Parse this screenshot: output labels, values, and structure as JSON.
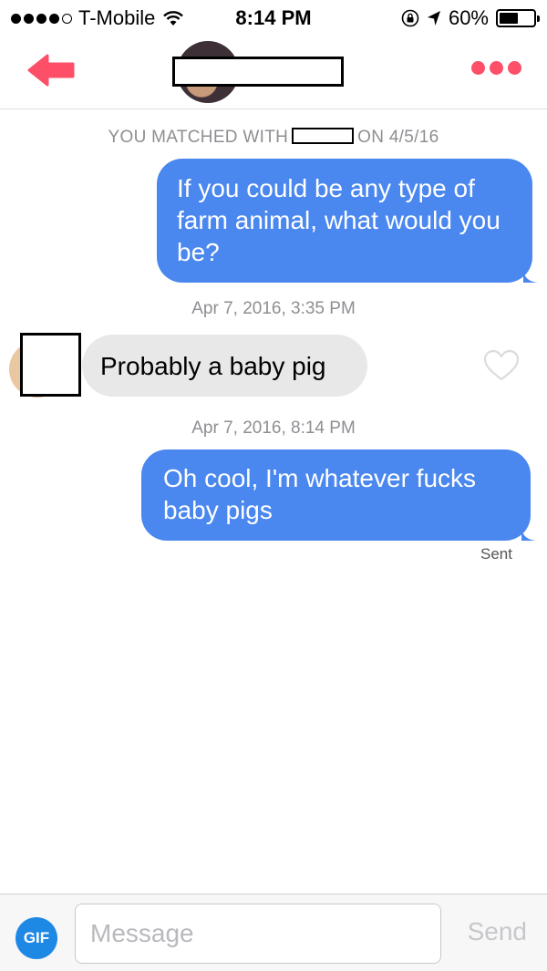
{
  "status_bar": {
    "carrier": "T-Mobile",
    "time": "8:14 PM",
    "battery_percent": "60%",
    "battery_level": 0.6,
    "signal_bars_filled": 4,
    "signal_bars_total": 5
  },
  "header": {
    "back_icon": "back-arrow-icon",
    "menu_icon": "more-dots-icon",
    "accent_color": "#fd5068"
  },
  "conversation": {
    "match_notice_before": "YOU MATCHED WITH",
    "match_notice_after": "ON 4/5/16",
    "messages": [
      {
        "direction": "outgoing",
        "text": "If you could be any type of farm animal, what would you be?"
      },
      {
        "timestamp": "Apr 7, 2016, 3:35 PM"
      },
      {
        "direction": "incoming",
        "text": "Probably a baby pig"
      },
      {
        "timestamp": "Apr 7, 2016, 8:14 PM"
      },
      {
        "direction": "outgoing",
        "text": "Oh cool, I'm whatever fucks baby pigs",
        "status": "Sent"
      }
    ]
  },
  "composer": {
    "gif_label": "GIF",
    "placeholder": "Message",
    "send_label": "Send"
  },
  "colors": {
    "outgoing_bubble": "#4a87ee",
    "incoming_bubble": "#e8e8e8",
    "gif_button": "#1e88e5"
  }
}
